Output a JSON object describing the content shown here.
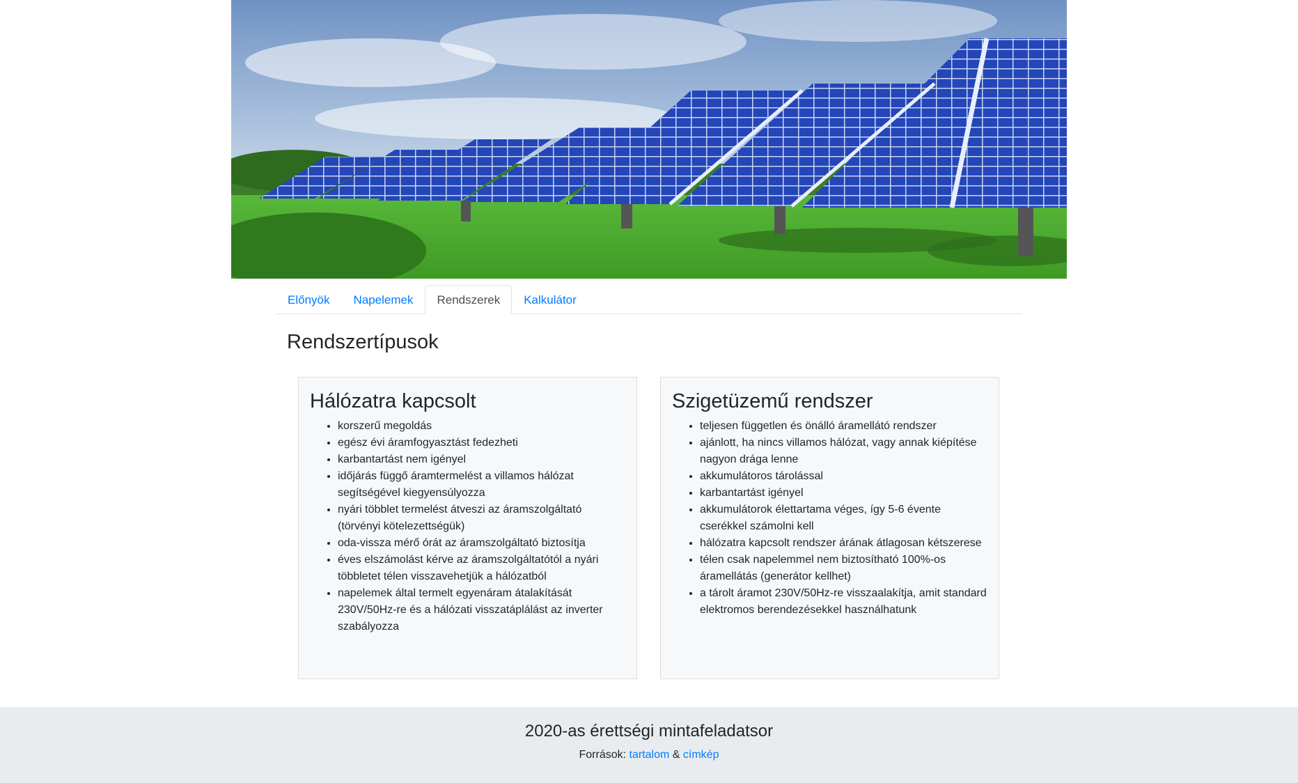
{
  "banner": {
    "alt": "solar-panels-photo"
  },
  "tabs": [
    {
      "label": "Előnyök",
      "active": false
    },
    {
      "label": "Napelemek",
      "active": false
    },
    {
      "label": "Rendszerek",
      "active": true
    },
    {
      "label": "Kalkulátor",
      "active": false
    }
  ],
  "main": {
    "title": "Rendszertípusok",
    "cards": [
      {
        "title": "Hálózatra kapcsolt",
        "items": [
          "korszerű megoldás",
          "egész évi áramfogyasztást fedezheti",
          "karbantartást nem igényel",
          "időjárás függő áramtermelést a villamos hálózat segítségével kiegyensúlyozza",
          "nyári többlet termelést átveszi az áramszolgáltató (törvényi kötelezettségük)",
          "oda-vissza mérő órát az áramszolgáltató biztosítja",
          "éves elszámolást kérve az áramszolgáltatótól a nyári többletet télen visszavehetjük a hálózatból",
          "napelemek által termelt egyenáram átalakítását 230V/50Hz-re és a hálózati visszatáplálást az inverter szabályozza"
        ]
      },
      {
        "title": "Szigetüzemű rendszer",
        "items": [
          "teljesen független és önálló áramellátó rendszer",
          "ajánlott, ha nincs villamos hálózat, vagy annak kiépítése nagyon drága lenne",
          "akkumulátoros tárolással",
          "karbantartást igényel",
          "akkumulátorok élettartama véges, így 5-6 évente cserékkel számolni kell",
          "hálózatra kapcsolt rendszer árának átlagosan kétszerese",
          "télen csak napelemmel nem biztosítható 100%-os áramellátás (generátor kellhet)",
          "a tárolt áramot 230V/50Hz-re visszaalakítja, amit standard elektromos berendezésekkel használhatunk"
        ]
      }
    ]
  },
  "footer": {
    "title": "2020-as érettségi mintafeladatsor",
    "sources_prefix": "Források:",
    "link1": "tartalom",
    "separator": "&",
    "link2": "címkép"
  },
  "colors": {
    "link": "#007bff",
    "footer_bg": "#e9ecef",
    "card_bg": "#f7f8f9"
  }
}
